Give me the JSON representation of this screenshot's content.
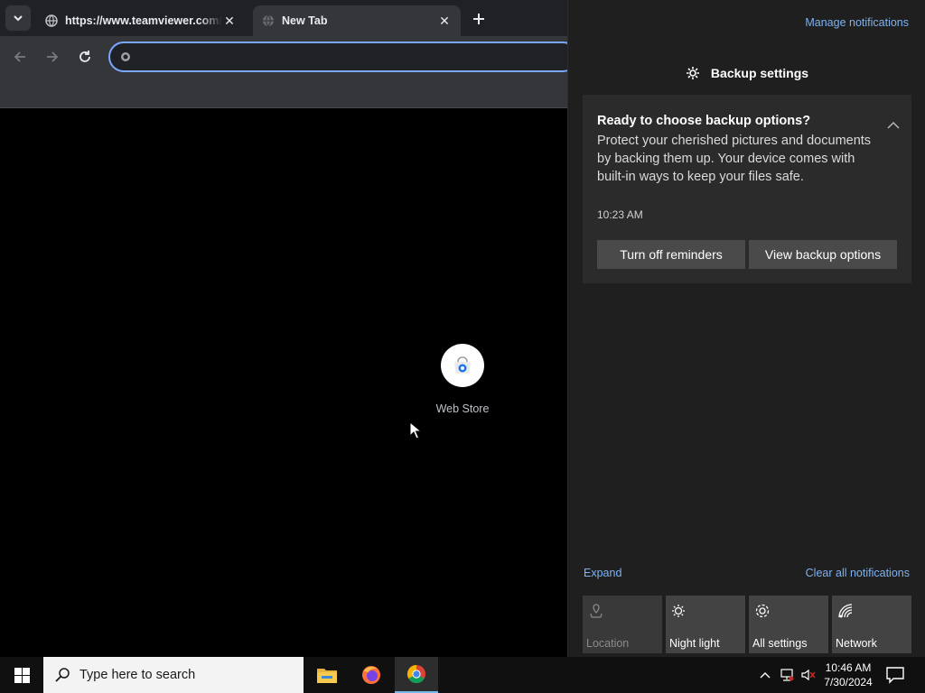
{
  "browser": {
    "tabs": [
      {
        "title": "https://www.teamviewer.com/",
        "active": false
      },
      {
        "title": "New Tab",
        "active": true
      }
    ],
    "omnibox": {
      "value": "",
      "placeholder": ""
    },
    "shortcuts": [
      {
        "label": "Web Store",
        "icon": "web-store-icon"
      }
    ]
  },
  "action_center": {
    "manage_notifications": "Manage notifications",
    "group_title": "Backup settings",
    "notification": {
      "title": "Ready to choose backup options?",
      "body": "Protect your cherished pictures and documents by backing them up. Your device comes with built-in ways to keep your files safe.",
      "time": "10:23 AM",
      "buttons": [
        "Turn off reminders",
        "View backup options"
      ]
    },
    "expand": "Expand",
    "clear_all": "Clear all notifications",
    "quick_actions": [
      {
        "label": "Location",
        "icon": "location-icon",
        "enabled": false
      },
      {
        "label": "Night light",
        "icon": "night-light-icon",
        "enabled": true
      },
      {
        "label": "All settings",
        "icon": "settings-icon",
        "enabled": true
      },
      {
        "label": "Network",
        "icon": "network-icon",
        "enabled": true
      }
    ]
  },
  "taskbar": {
    "search_placeholder": "Type here to search",
    "apps": [
      "file-explorer-icon",
      "firefox-icon",
      "chrome-icon"
    ],
    "clock": {
      "time": "10:46 AM",
      "date": "7/30/2024"
    }
  },
  "colors": {
    "accent_link": "#7fb2f0",
    "toast_bg": "#2b2b2b",
    "omnibox_border": "#7aa7ff"
  }
}
